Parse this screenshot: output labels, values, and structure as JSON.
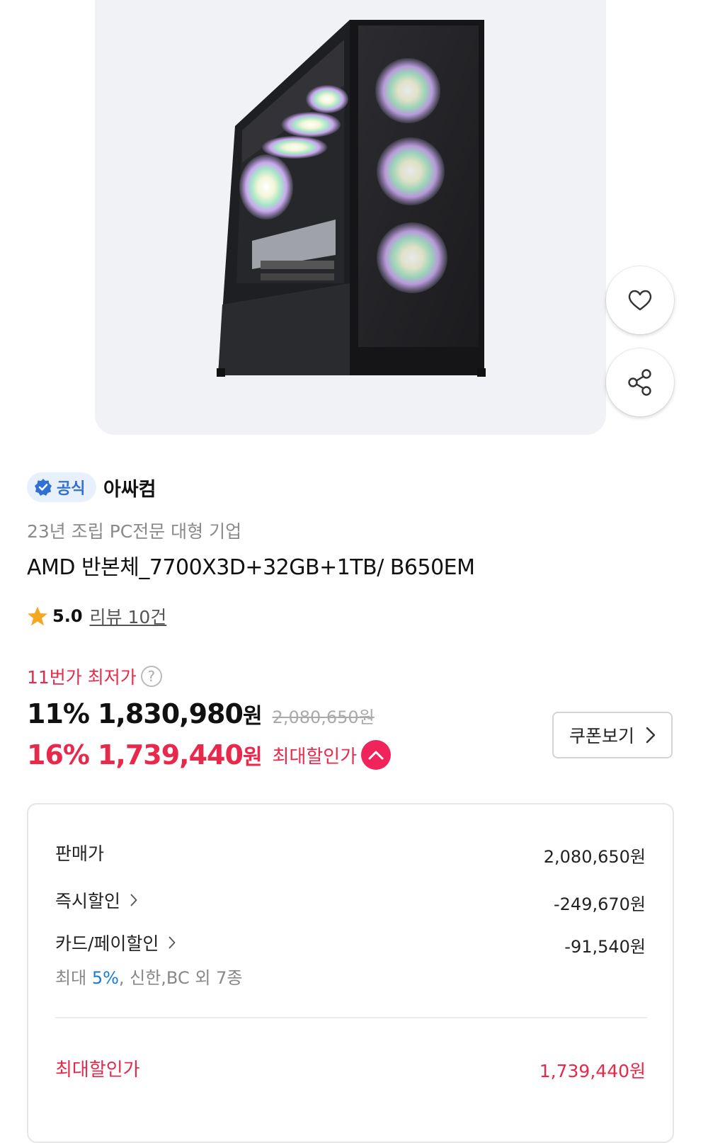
{
  "seller": {
    "badge_label": "공식",
    "name": "아싸컴",
    "subtitle": "23년 조립 PC전문 대형 기업"
  },
  "product": {
    "name": "AMD 반본체_7700X3D+32GB+1TB/ B650EM",
    "rating": "5.0",
    "review_link": "리뷰 10건"
  },
  "pricing": {
    "lowest_label": "11번가 최저가",
    "help_symbol": "?",
    "discount_rate": "11%",
    "price": "1,830,980",
    "won": "원",
    "original_price": "2,080,650원",
    "max_discount_rate": "16%",
    "max_price": "1,739,440",
    "max_label": "최대할인가",
    "coupon_label": "쿠폰보기"
  },
  "breakdown": {
    "sale_label": "판매가",
    "sale_value": "2,080,650원",
    "instant_label": "즉시할인",
    "instant_value": "-249,670원",
    "card_label": "카드/페이할인",
    "card_value": "-91,540원",
    "card_sub_prefix": "최대",
    "card_sub_rate": "5%",
    "card_sub_suffix": ", 신한,BC 외 7종",
    "final_label": "최대할인가",
    "final_value": "1,739,440원"
  },
  "colors": {
    "accent_red": "#e8294b",
    "badge_blue": "#2f6fd6",
    "link_blue": "#1a7bd4"
  },
  "icons": {
    "wishlist": "heart-icon",
    "share": "share-icon",
    "verified": "verified-check-icon",
    "rating": "star-icon"
  }
}
